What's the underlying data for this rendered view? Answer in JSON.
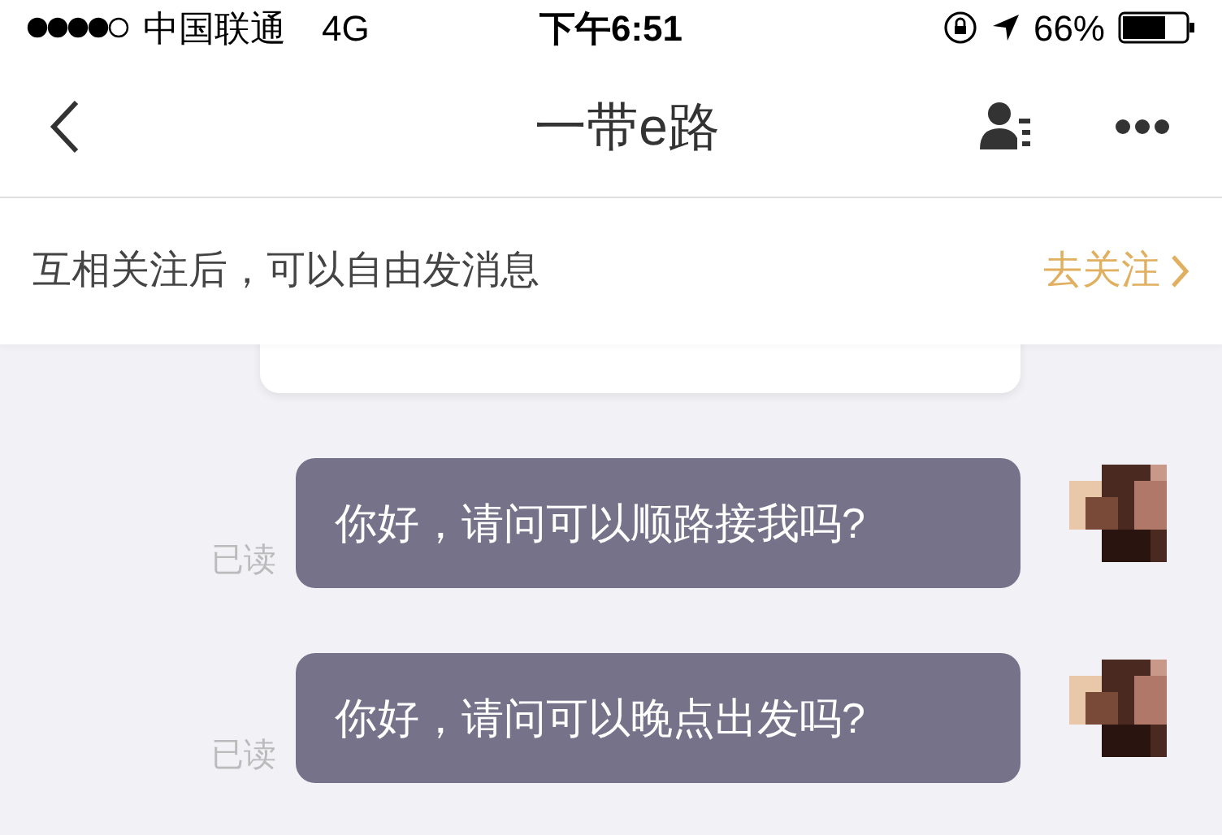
{
  "status_bar": {
    "carrier": "中国联通",
    "network": "4G",
    "time": "下午6:51",
    "battery": "66%"
  },
  "nav": {
    "title": "一带e路"
  },
  "follow_banner": {
    "text": "互相关注后，可以自由发消息",
    "action": "去关注"
  },
  "messages": [
    {
      "text": "你好，请问可以顺路接我吗?",
      "status": "已读"
    },
    {
      "text": "你好，请问可以晚点出发吗?",
      "status": "已读"
    }
  ]
}
